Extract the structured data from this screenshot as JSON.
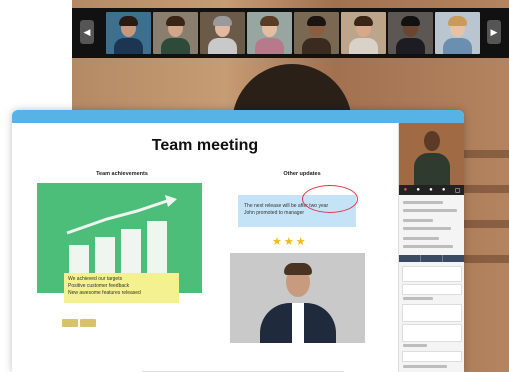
{
  "board": {
    "title": "Team meeting",
    "left_heading": "Team achievements",
    "right_heading": "Other updates",
    "yellow_note": {
      "line1": "We achieved our targets",
      "line2": "Positive customer feedback",
      "line3": "New awesome features released"
    },
    "blue_note": {
      "line1": "The next release will be after two year",
      "line2": "John promoted to manager"
    },
    "stars": "★★★"
  },
  "strip": {
    "prev": "◀",
    "next": "▶"
  },
  "toolbar_icons": [
    "menu-icon",
    "pen-icon",
    "eraser-icon",
    "sticky-note-icon",
    "shape-icon",
    "text-icon",
    "highlighter-icon",
    "pointer-icon",
    "stamp-icon",
    "share-icon",
    "comment-icon",
    "add-icon",
    "help-icon"
  ],
  "toolbar_glyphs": [
    "☰",
    "✎",
    "⌂",
    "▢",
    "◰",
    "T",
    "✐",
    "⇲",
    "⌖",
    "<",
    "⊡",
    "+",
    "?"
  ],
  "colors": {
    "topbar": "#57b3e6",
    "green_card": "#4cbe7a",
    "yellow_note": "#f3f190",
    "blue_note": "#c5e3f6",
    "stars": "#f2b81c",
    "scribble": "#e0344e"
  }
}
